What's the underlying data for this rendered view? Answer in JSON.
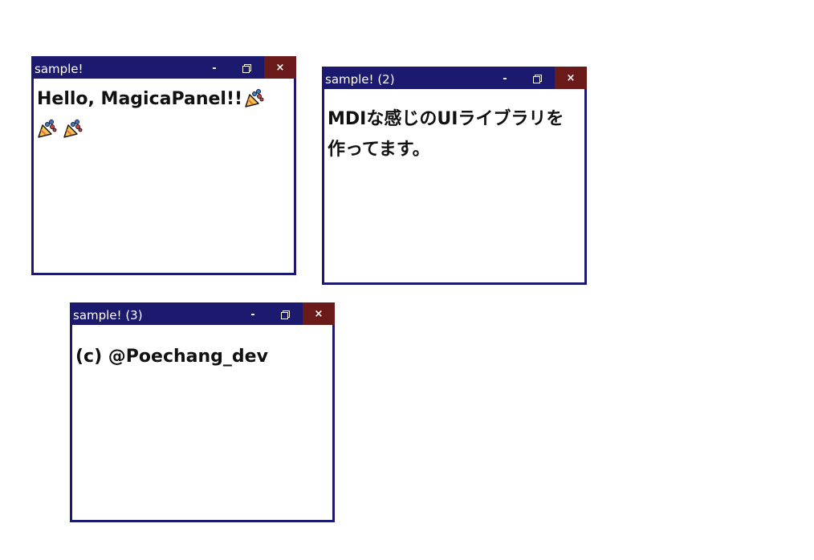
{
  "windows": [
    {
      "title": "sample!",
      "content_text": "Hello, MagicaPanel!!",
      "party_count": 3,
      "buttons": {
        "minimize": "-",
        "close": "×"
      }
    },
    {
      "title": "sample! (2)",
      "content_text": "MDIな感じのUIライブラリを作ってます。",
      "party_count": 0,
      "buttons": {
        "minimize": "-",
        "close": "×"
      }
    },
    {
      "title": "sample! (3)",
      "content_text": "(c) @Poechang_dev",
      "party_count": 0,
      "buttons": {
        "minimize": "-",
        "close": "×"
      }
    }
  ],
  "colors": {
    "titlebar": "#1c1a6e",
    "close_button": "#6b1a1a",
    "background": "#ffffff"
  },
  "icons": {
    "party": "party-popper-icon",
    "restore": "restore-icon"
  }
}
